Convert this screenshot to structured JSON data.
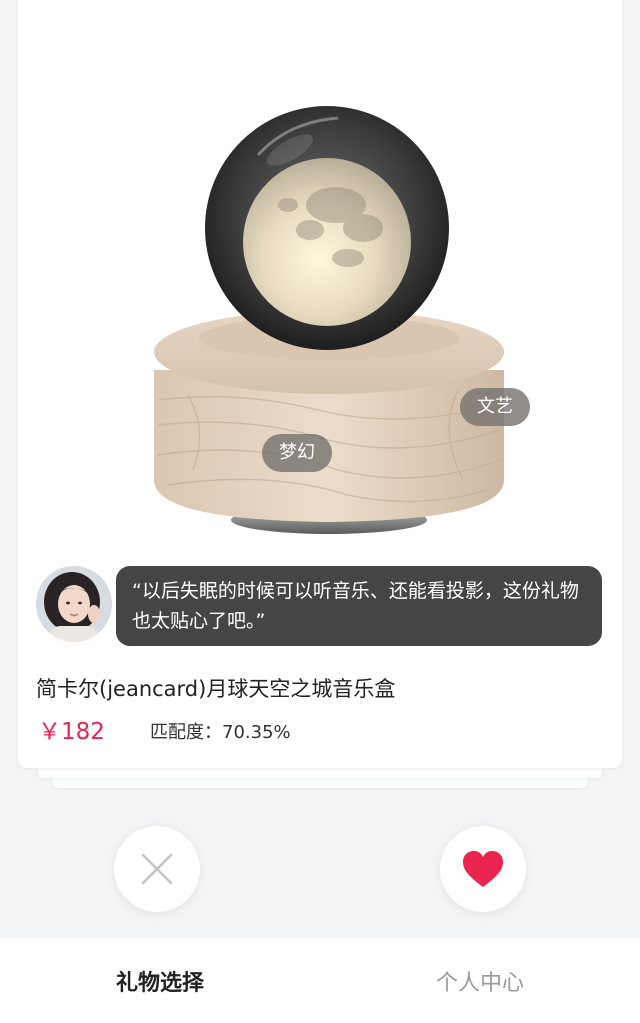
{
  "product": {
    "image_alt": "月球天空之城音乐盒",
    "tags": [
      "文艺",
      "梦幻"
    ],
    "quote": "“以后失眠的时候可以听音乐、还能看投影，这份礼物也太贴心了吧。”",
    "title": "简卡尔(jeancard)月球天空之城音乐盒",
    "price": "￥182",
    "match": "匹配度：70.35%"
  },
  "actions": {
    "dislike_icon": "close-icon",
    "like_icon": "heart-icon",
    "like_color": "#e8244f"
  },
  "tabbar": {
    "tabs": [
      {
        "label": "礼物选择",
        "active": true
      },
      {
        "label": "个人中心",
        "active": false
      }
    ]
  }
}
